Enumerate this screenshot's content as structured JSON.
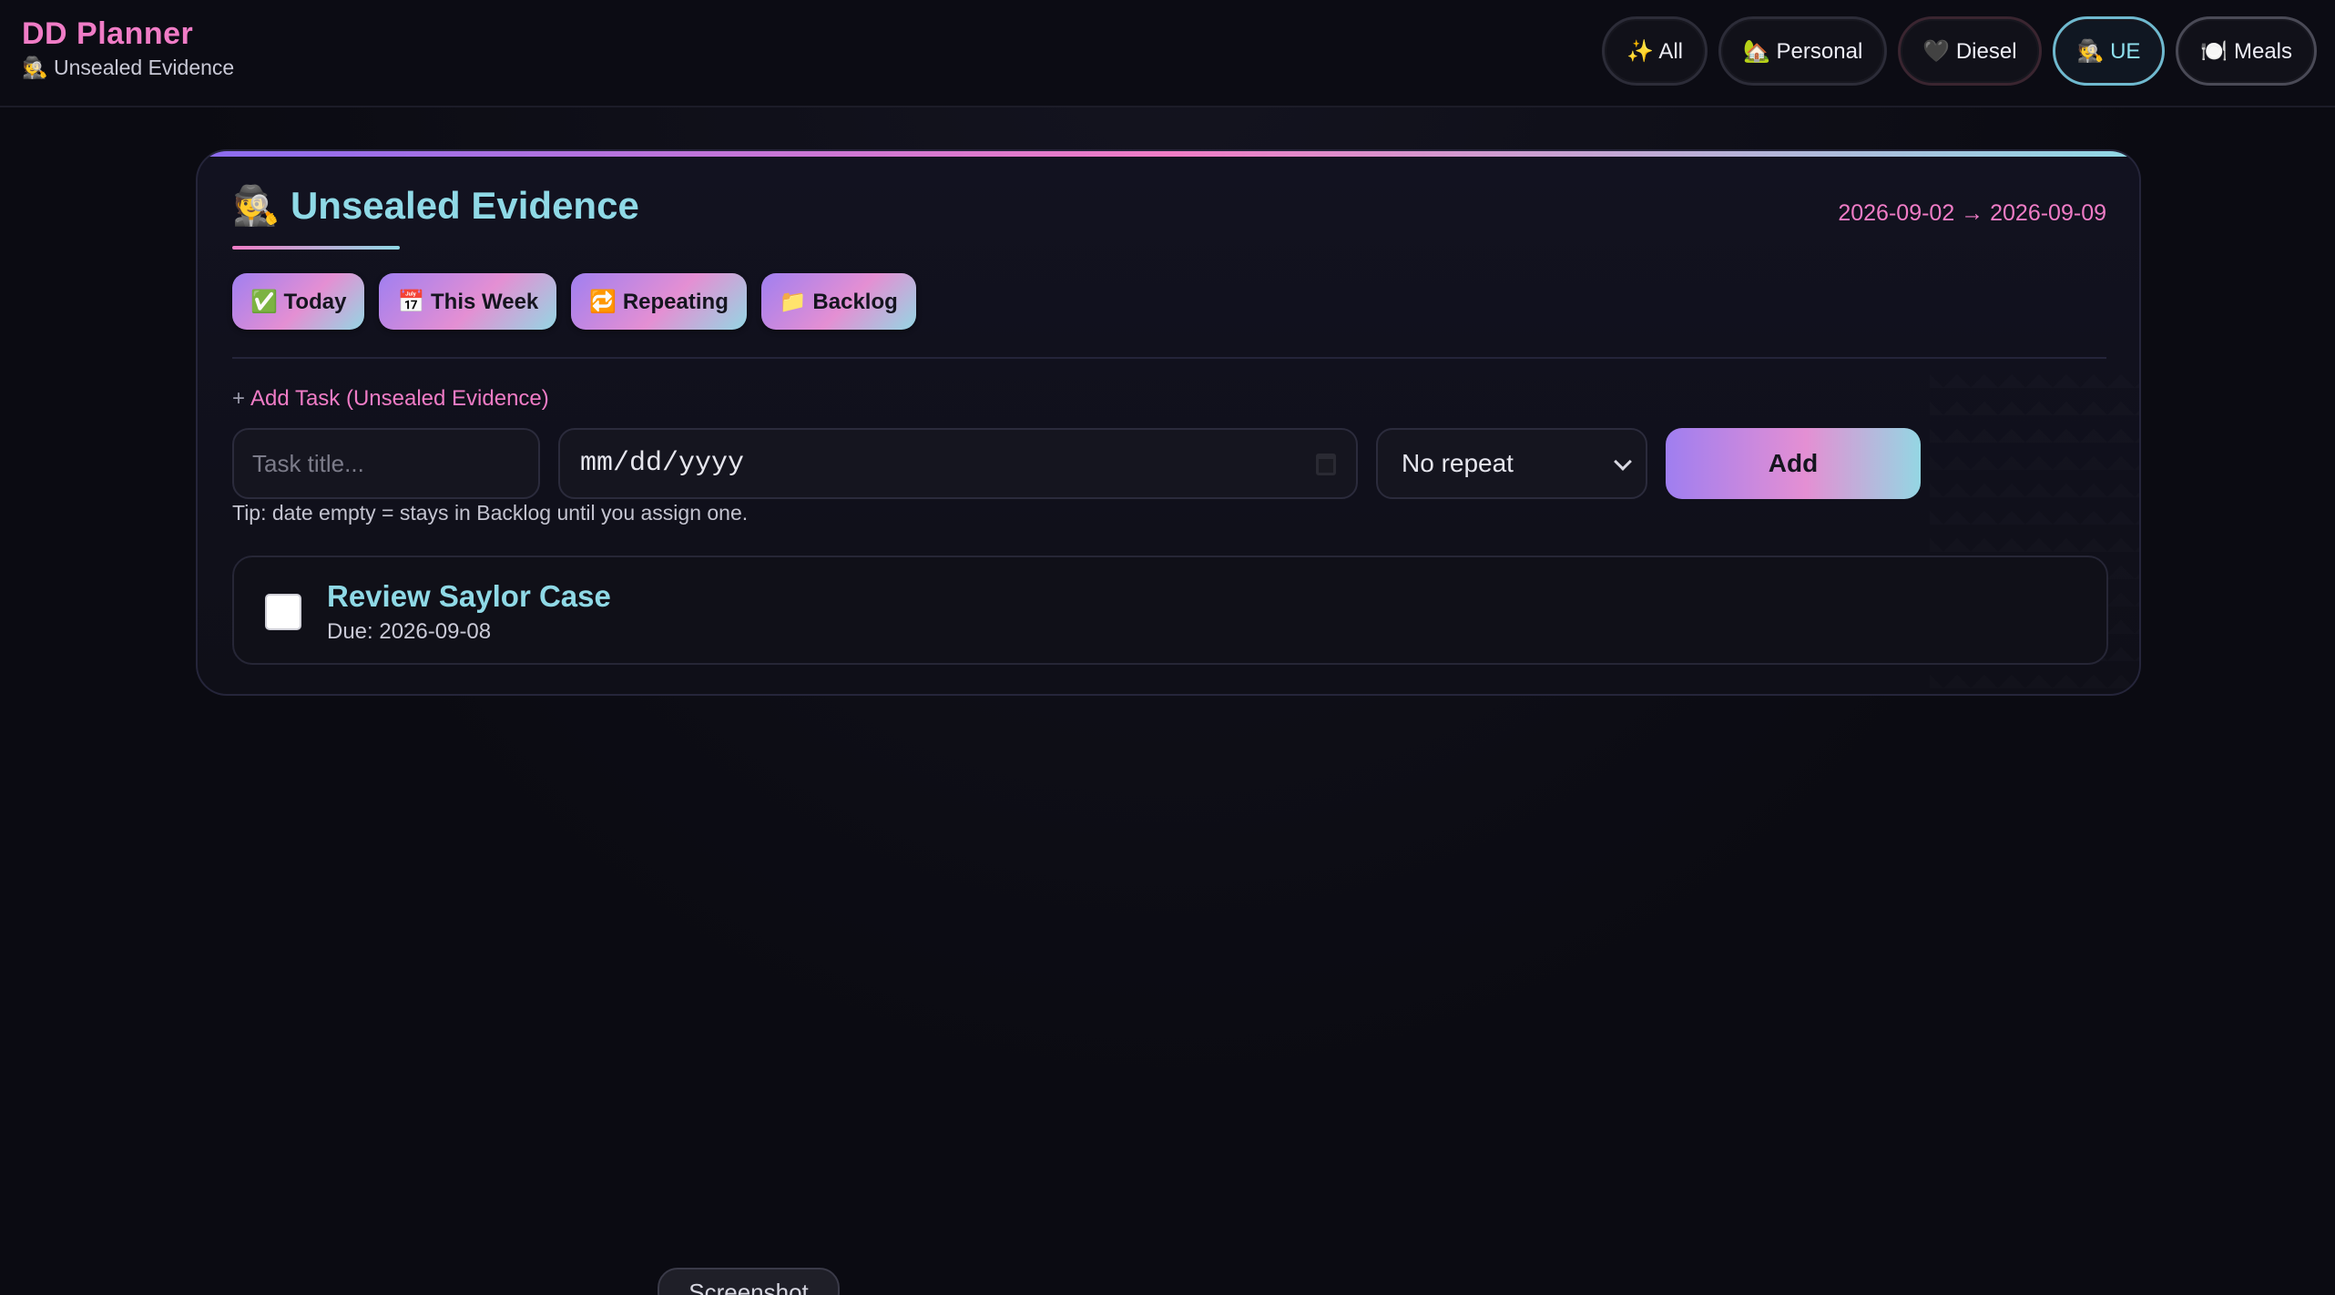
{
  "brand": {
    "title": "DD Planner",
    "subtitle": "🕵️ Unsealed Evidence"
  },
  "nav_pills": [
    {
      "icon": "sparkles-icon",
      "label": "✨ All"
    },
    {
      "icon": "house-icon",
      "label": "🏡 Personal"
    },
    {
      "icon": "heart-icon",
      "label": "🖤 Diesel"
    },
    {
      "icon": "detective-icon",
      "label": "🕵️ UE",
      "active": true
    },
    {
      "icon": "plate-icon",
      "label": "🍽️ Meals"
    }
  ],
  "panel": {
    "title": "🕵️ Unsealed Evidence",
    "date_range": "2026-09-02 → 2026-09-09",
    "tabs": [
      {
        "label": "✅ Today"
      },
      {
        "label": "📅 This Week"
      },
      {
        "label": "🔁 Repeating"
      },
      {
        "label": "📁 Backlog"
      }
    ],
    "add_label": "Add Task (Unsealed Evidence)",
    "add_plus": "+",
    "form": {
      "title_placeholder": "Task title...",
      "date_placeholder": "mm/dd/yyyy",
      "repeat_selected": "No repeat",
      "add_button": "Add"
    },
    "tip": "Tip: date empty = stays in Backlog until you assign one.",
    "tasks": [
      {
        "title": "Review Saylor Case",
        "due": "Due: 2026-09-08",
        "checked": false
      }
    ]
  },
  "overlay": {
    "screenshot_chip": "Screenshot"
  },
  "colors": {
    "accent_pink": "#f07cc6",
    "accent_cyan": "#8fd9e6",
    "accent_purple": "#9f7ef0",
    "background": "#0b0b12"
  }
}
